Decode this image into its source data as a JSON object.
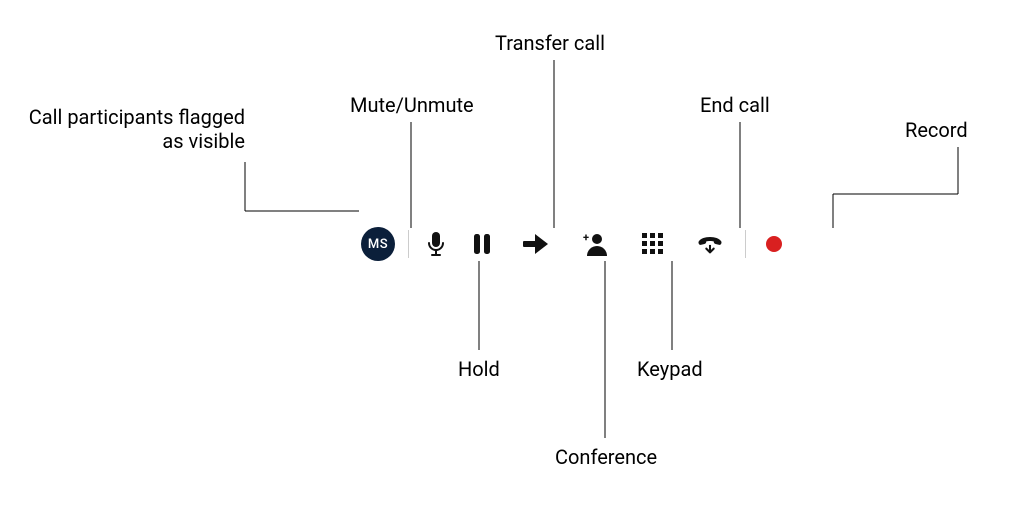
{
  "diagram": {
    "avatar_initials": "MS",
    "colors": {
      "avatar_bg": "#0b1f3a",
      "record_red": "#d92020",
      "separator": "#cccccc"
    },
    "annotations": {
      "participants": "Call participants flagged as visible",
      "participants_line2": "as visible",
      "participants_line1": "Call participants flagged",
      "mute": "Mute/Unmute",
      "transfer": "Transfer call",
      "end_call": "End call",
      "record": "Record",
      "hold": "Hold",
      "keypad": "Keypad",
      "conference": "Conference"
    },
    "icons": [
      "participant-avatar",
      "microphone-icon",
      "pause-icon",
      "arrow-right-icon",
      "add-person-icon",
      "keypad-icon",
      "phone-down-icon",
      "record-icon"
    ]
  }
}
